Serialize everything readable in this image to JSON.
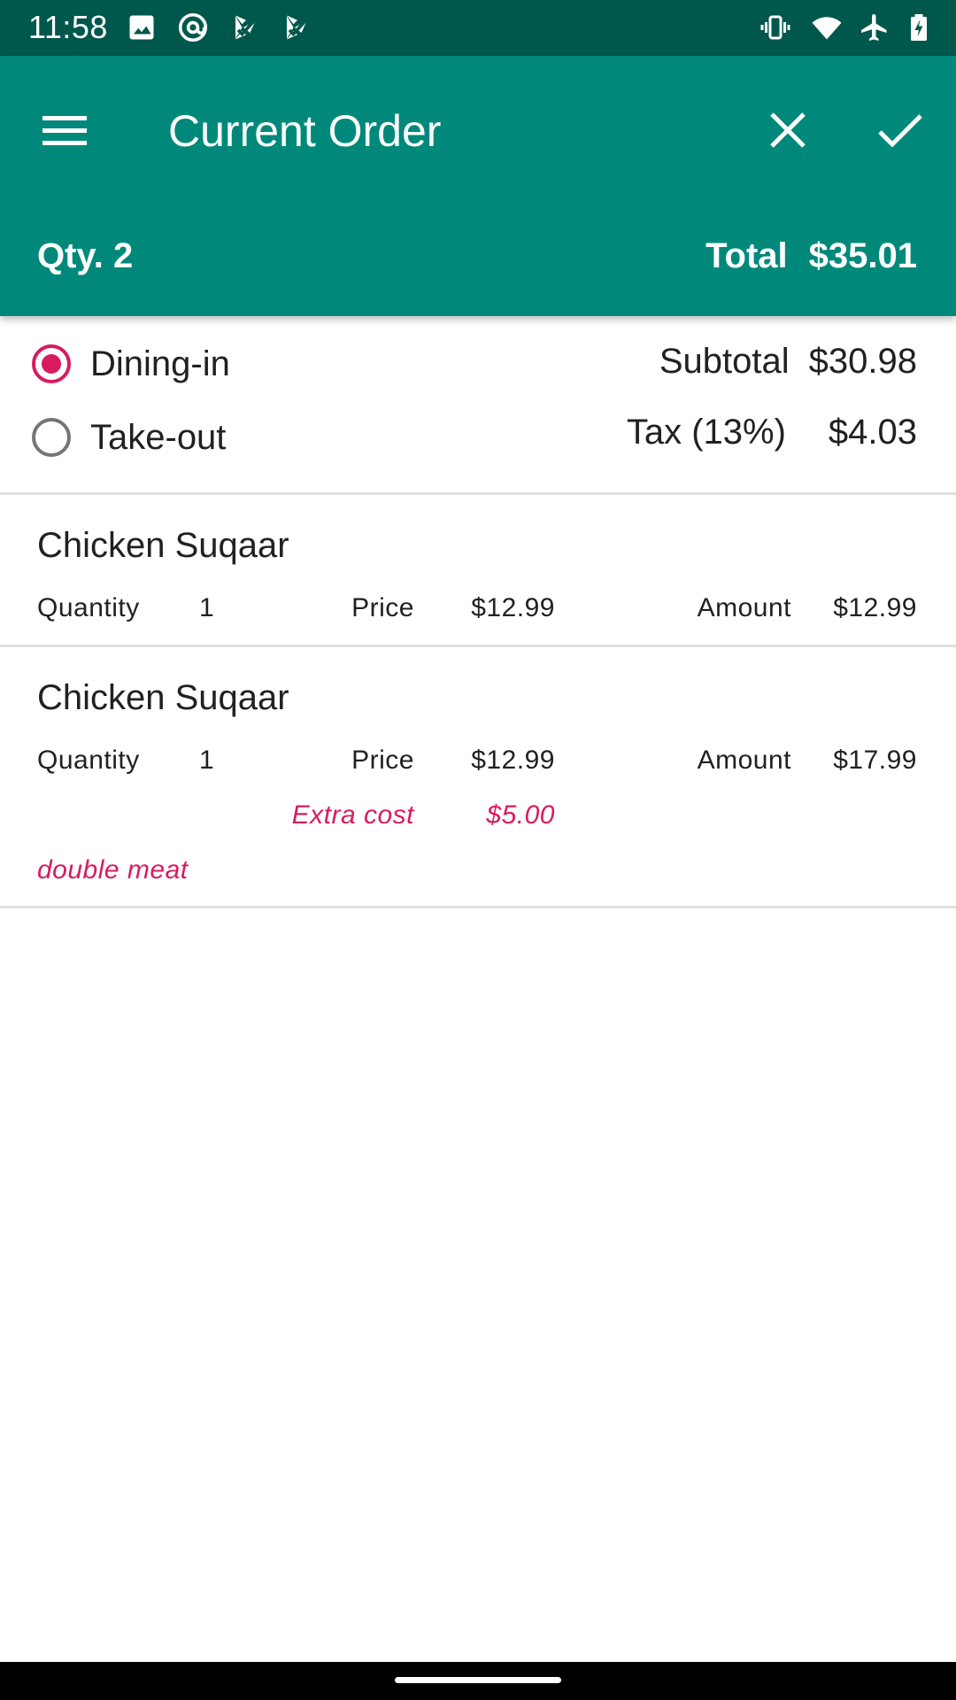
{
  "status_bar": {
    "time": "11:58",
    "left_icons": [
      "image-icon",
      "at-sign-icon",
      "play-store-icon",
      "play-store-icon"
    ],
    "right_icons": [
      "vibrate-icon",
      "wifi-icon",
      "airplane-mode-icon",
      "battery-charging-icon"
    ]
  },
  "app_bar": {
    "title": "Current Order",
    "qty_label": "Qty. 2",
    "total_label": "Total",
    "total_value": "$35.01",
    "color": "#00897b"
  },
  "order_type": {
    "options": [
      {
        "label": "Dining-in",
        "selected": true
      },
      {
        "label": "Take-out",
        "selected": false
      }
    ],
    "accent": "#d81b60"
  },
  "totals": {
    "subtotal_label": "Subtotal",
    "subtotal_value": "$30.98",
    "tax_label": "Tax (13%)",
    "tax_value": "$4.03"
  },
  "items": [
    {
      "name": "Chicken Suqaar",
      "quantity_label": "Quantity",
      "quantity": "1",
      "price_label": "Price",
      "price": "$12.99",
      "amount_label": "Amount",
      "amount": "$12.99"
    },
    {
      "name": "Chicken Suqaar",
      "quantity_label": "Quantity",
      "quantity": "1",
      "price_label": "Price",
      "price": "$12.99",
      "amount_label": "Amount",
      "amount": "$17.99",
      "extra_cost_label": "Extra cost",
      "extra_cost": "$5.00",
      "note": "double meat"
    }
  ]
}
